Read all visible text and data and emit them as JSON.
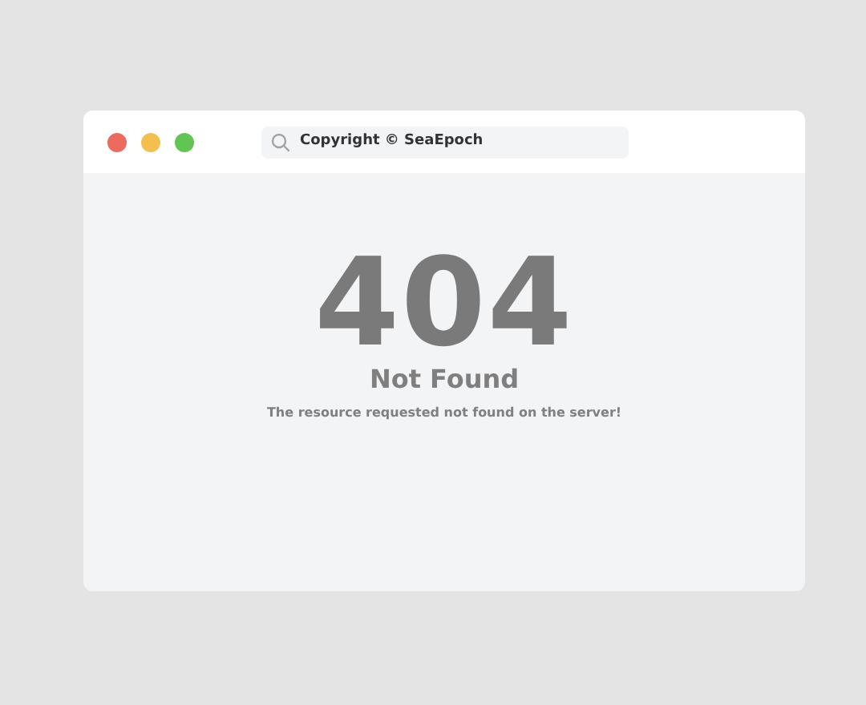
{
  "window": {
    "controls": [
      {
        "color": "#ec6a5e"
      },
      {
        "color": "#f4bf4f"
      },
      {
        "color": "#61c554"
      }
    ],
    "address_bar": {
      "value": "Copyright © SeaEpoch"
    }
  },
  "error": {
    "code": "404",
    "title": "Not Found",
    "message": "The resource requested not found on the server!"
  }
}
